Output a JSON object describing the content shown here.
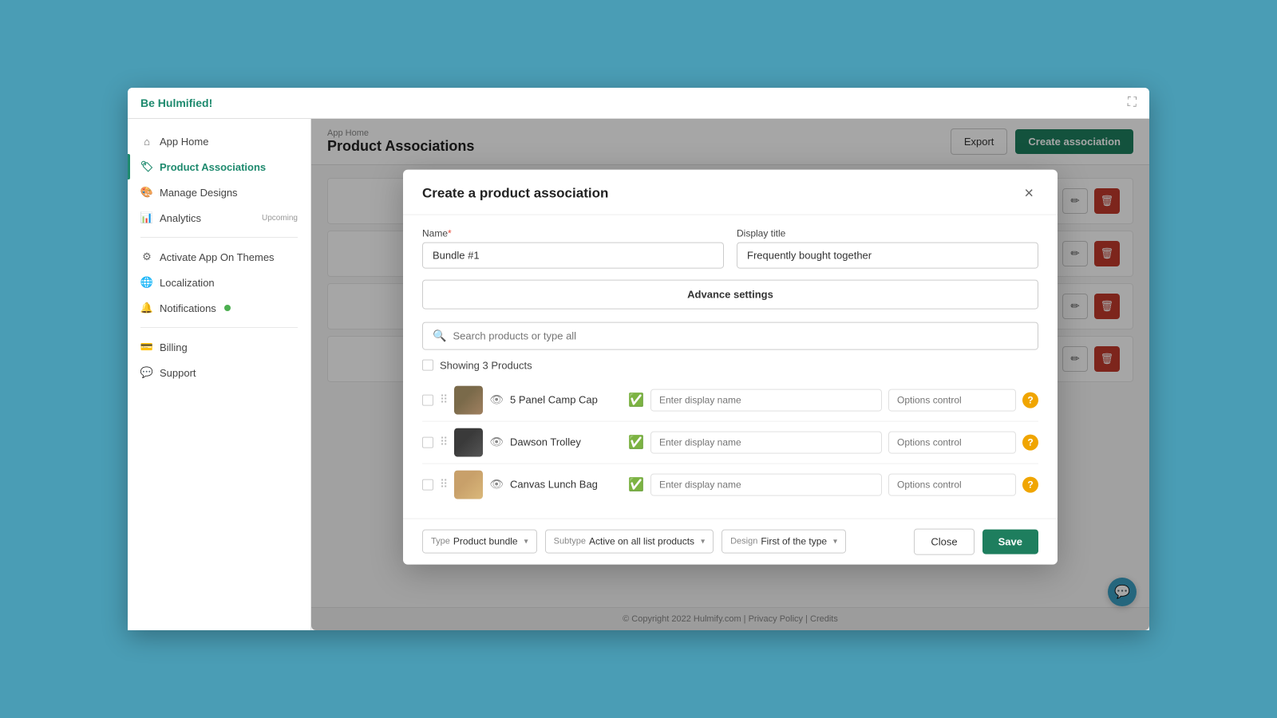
{
  "app": {
    "brand_be": "Be",
    "brand_name": "Hulmified!",
    "fullscreen_icon": "⛶"
  },
  "sidebar": {
    "items": [
      {
        "id": "app-home",
        "icon": "⌂",
        "label": "App Home",
        "active": false
      },
      {
        "id": "product-associations",
        "icon": "🏷",
        "label": "Product Associations",
        "active": true
      },
      {
        "id": "manage-designs",
        "icon": "🎨",
        "label": "Manage Designs",
        "active": false
      },
      {
        "id": "analytics",
        "icon": "📊",
        "label": "Analytics",
        "active": false,
        "tag": "Upcoming"
      },
      {
        "id": "activate-app",
        "icon": "⚙",
        "label": "Activate App On Themes",
        "active": false
      },
      {
        "id": "localization",
        "icon": "🌐",
        "label": "Localization",
        "active": false
      },
      {
        "id": "notifications",
        "icon": "🔔",
        "label": "Notifications",
        "active": false,
        "badge": true
      },
      {
        "id": "billing",
        "icon": "💳",
        "label": "Billing",
        "active": false
      },
      {
        "id": "support",
        "icon": "💬",
        "label": "Support",
        "active": false
      }
    ]
  },
  "topbar": {
    "breadcrumb": "App Home",
    "page_title": "Product Associations",
    "export_label": "Export",
    "create_label": "Create association"
  },
  "background_rows": [
    {
      "id": "row1"
    },
    {
      "id": "row2"
    },
    {
      "id": "row3"
    },
    {
      "id": "row4"
    }
  ],
  "footer": {
    "text": "© Copyright 2022 Hulmify.com | Privacy Policy | Credits"
  },
  "modal": {
    "title": "Create a product association",
    "close_icon": "×",
    "name_label": "Name",
    "name_required": "*",
    "name_value": "Bundle #1",
    "display_title_label": "Display title",
    "display_title_value": "Frequently bought together",
    "advance_settings_label": "Advance settings",
    "search_placeholder": "Search products or type all",
    "showing_label": "Showing 3 Products",
    "products": [
      {
        "id": "p1",
        "name": "5 Panel Camp Cap",
        "display_name_placeholder": "Enter display name",
        "options_placeholder": "Options control",
        "verified": true,
        "thumb_type": "cap"
      },
      {
        "id": "p2",
        "name": "Dawson Trolley",
        "display_name_placeholder": "Enter display name",
        "options_placeholder": "Options control",
        "verified": true,
        "thumb_type": "bag"
      },
      {
        "id": "p3",
        "name": "Canvas Lunch Bag",
        "display_name_placeholder": "Enter display name",
        "options_placeholder": "Options control",
        "verified": true,
        "thumb_type": "lunch"
      }
    ],
    "footer": {
      "type_prefix": "Type",
      "type_value": "Product bundle",
      "subtype_prefix": "Subtype",
      "subtype_value": "Active on all list products",
      "design_prefix": "Design",
      "design_value": "First of the type",
      "close_label": "Close",
      "save_label": "Save"
    }
  }
}
